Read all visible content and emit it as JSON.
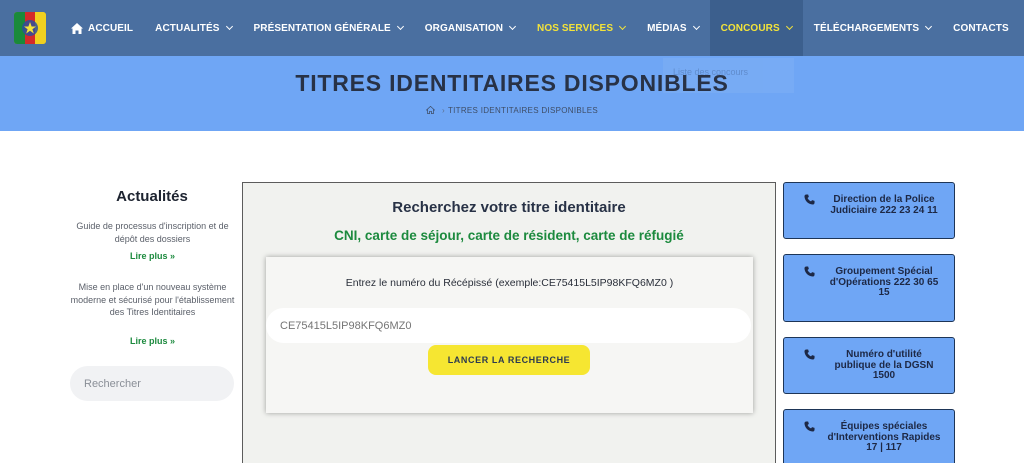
{
  "nav": {
    "items": [
      {
        "label": "ACCUEIL"
      },
      {
        "label": "ACTUALITÉS"
      },
      {
        "label": "PRÉSENTATION GÉNÉRALE"
      },
      {
        "label": "ORGANISATION"
      },
      {
        "label": "NOS SERVICES"
      },
      {
        "label": "MÉDIAS"
      },
      {
        "label": "CONCOURS"
      },
      {
        "label": "TÉLÉCHARGEMENTS"
      },
      {
        "label": "CONTACTS"
      }
    ],
    "dropdown_ghost": "Liste des concours",
    "colors": {
      "bar": "#4a6fa0",
      "highlight": "#f3e33a",
      "hero": "#6fa6f5"
    }
  },
  "hero": {
    "title": "TITRES IDENTITAIRES DISPONIBLES",
    "breadcrumb_current": "TITRES IDENTITAIRES DISPONIBLES"
  },
  "sidebar": {
    "title": "Actualités",
    "news": [
      {
        "text": "Guide de processus d'inscription et de dépôt des dossiers",
        "more": "Lire plus »"
      },
      {
        "text": "Mise en place d'un nouveau système moderne et sécurisé pour l'établissement des Titres Identitaires",
        "more": "Lire plus »"
      }
    ],
    "search_placeholder": "Rechercher"
  },
  "main": {
    "title": "Recherchez votre titre identitaire",
    "subtitle": "CNI, carte de séjour, carte de résident, carte de réfugié",
    "form": {
      "label": "Entrez le numéro du Récépissé (exemple:CE75415L5IP98KFQ6MZ0 )",
      "placeholder": "CE75415L5IP98KFQ6MZ0",
      "button": "LANCER LA RECHERCHE"
    }
  },
  "contacts": [
    {
      "text": "Direction de la Police Judiciaire 222 23 24 11"
    },
    {
      "text": "Groupement Spécial d'Opérations 222 30 65 15"
    },
    {
      "text": "Numéro d'utilité publique de la DGSN 1500"
    },
    {
      "text": "Équipes spéciales d'Interventions Rapides 17 | 117"
    }
  ]
}
